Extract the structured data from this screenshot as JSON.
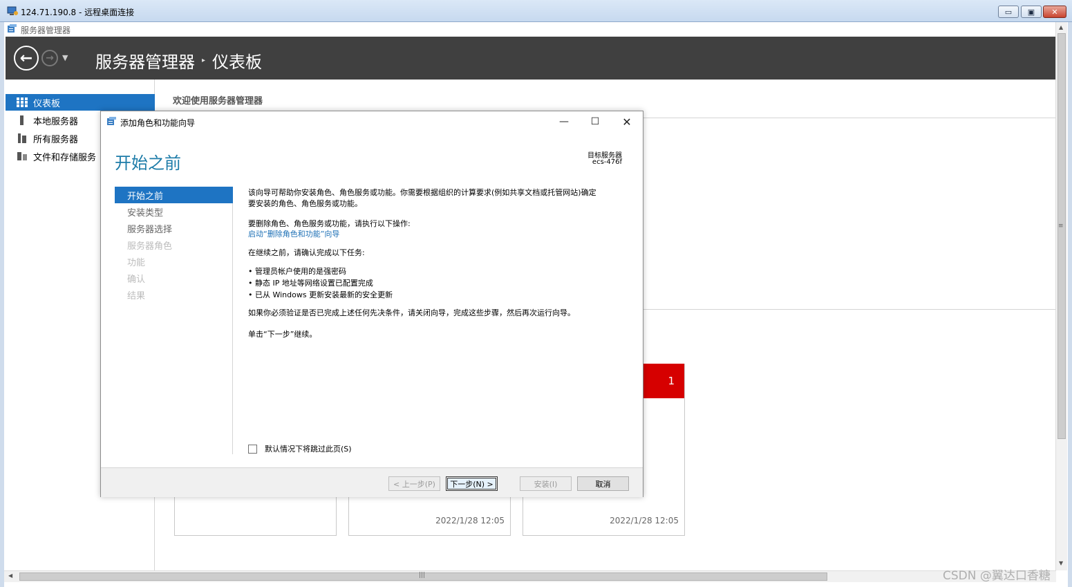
{
  "rdp": {
    "title": "124.71.190.8 - 远程桌面连接",
    "min": "▭",
    "max": "▣",
    "close": "✕"
  },
  "app": {
    "title": "服务器管理器"
  },
  "header": {
    "crumb_root": "服务器管理器",
    "crumb_sep": "▸",
    "crumb_current": "仪表板"
  },
  "sidebar": {
    "items": [
      {
        "label": "仪表板"
      },
      {
        "label": "本地服务器"
      },
      {
        "label": "所有服务器"
      },
      {
        "label": "文件和存储服务"
      }
    ]
  },
  "main": {
    "welcome": "欢迎使用服务器管理器",
    "badge_count": "1",
    "tile_times": [
      "2022/1/28 12:05",
      "2022/1/28 12:05"
    ]
  },
  "wizard": {
    "title": "添加角色和功能向导",
    "heading": "开始之前",
    "target_label": "目标服务器",
    "target_value": "ecs-476f",
    "steps": [
      "开始之前",
      "安装类型",
      "服务器选择",
      "服务器角色",
      "功能",
      "确认",
      "结果"
    ],
    "intro_line1": "该向导可帮助你安装角色、角色服务或功能。你需要根据组织的计算要求(例如共享文档或托管网站)确定",
    "intro_line2": "要安装的角色、角色服务或功能。",
    "remove_text": "要删除角色、角色服务或功能，请执行以下操作:",
    "remove_link": "启动“删除角色和功能”向导",
    "confirm_text": "在继续之前，请确认完成以下任务:",
    "tasks": [
      "• 管理员帐户使用的是强密码",
      "• 静态 IP 地址等网络设置已配置完成",
      "• 已从 Windows 更新安装最新的安全更新"
    ],
    "verify_text": "如果你必须验证是否已完成上述任何先决条件，请关闭向导，完成这些步骤，然后再次运行向导。",
    "continue_text": "单击“下一步”继续。",
    "skip_label": "默认情况下将跳过此页(S)",
    "buttons": {
      "prev": "< 上一步(P)",
      "next": "下一步(N) >",
      "install": "安装(I)",
      "cancel": "取消"
    }
  },
  "watermark": "CSDN @翼达口香糖",
  "colors": {
    "header_bg": "#404040",
    "accent": "#1e74c3",
    "heading": "#1c7ba8",
    "badge": "#d60000"
  }
}
